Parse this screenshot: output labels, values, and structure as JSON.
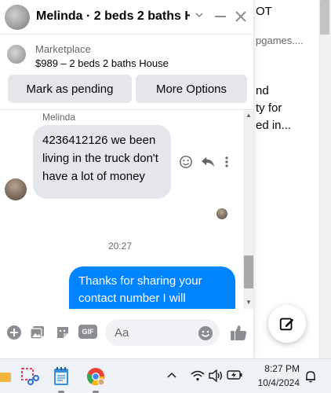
{
  "background_page": {
    "line1": "OT",
    "line2": "pgames....",
    "line3": "nd",
    "line4": "ty for",
    "line5": "ed in..."
  },
  "chat": {
    "header": {
      "title": "Melinda · 2 beds 2 baths H..."
    },
    "listing": {
      "source": "Marketplace",
      "title": "$989 – 2 beds 2 baths House",
      "mark_pending_label": "Mark as pending",
      "more_options_label": "More Options"
    },
    "messages": {
      "sender_name": "Melinda",
      "incoming_text": "4236412126 we been living in the truck don't have a lot of money",
      "time_divider": "20:27",
      "outgoing_text": "Thanks for sharing your contact number I will contact at your number as"
    },
    "composer": {
      "placeholder": "Aa",
      "gif_label": "GIF"
    }
  },
  "taskbar": {
    "time": "8:27 PM",
    "date": "10/4/2024"
  },
  "colors": {
    "accent_blue": "#0084ff",
    "bubble_gray": "#e4e6eb",
    "icon_gray": "#8a8d91"
  }
}
